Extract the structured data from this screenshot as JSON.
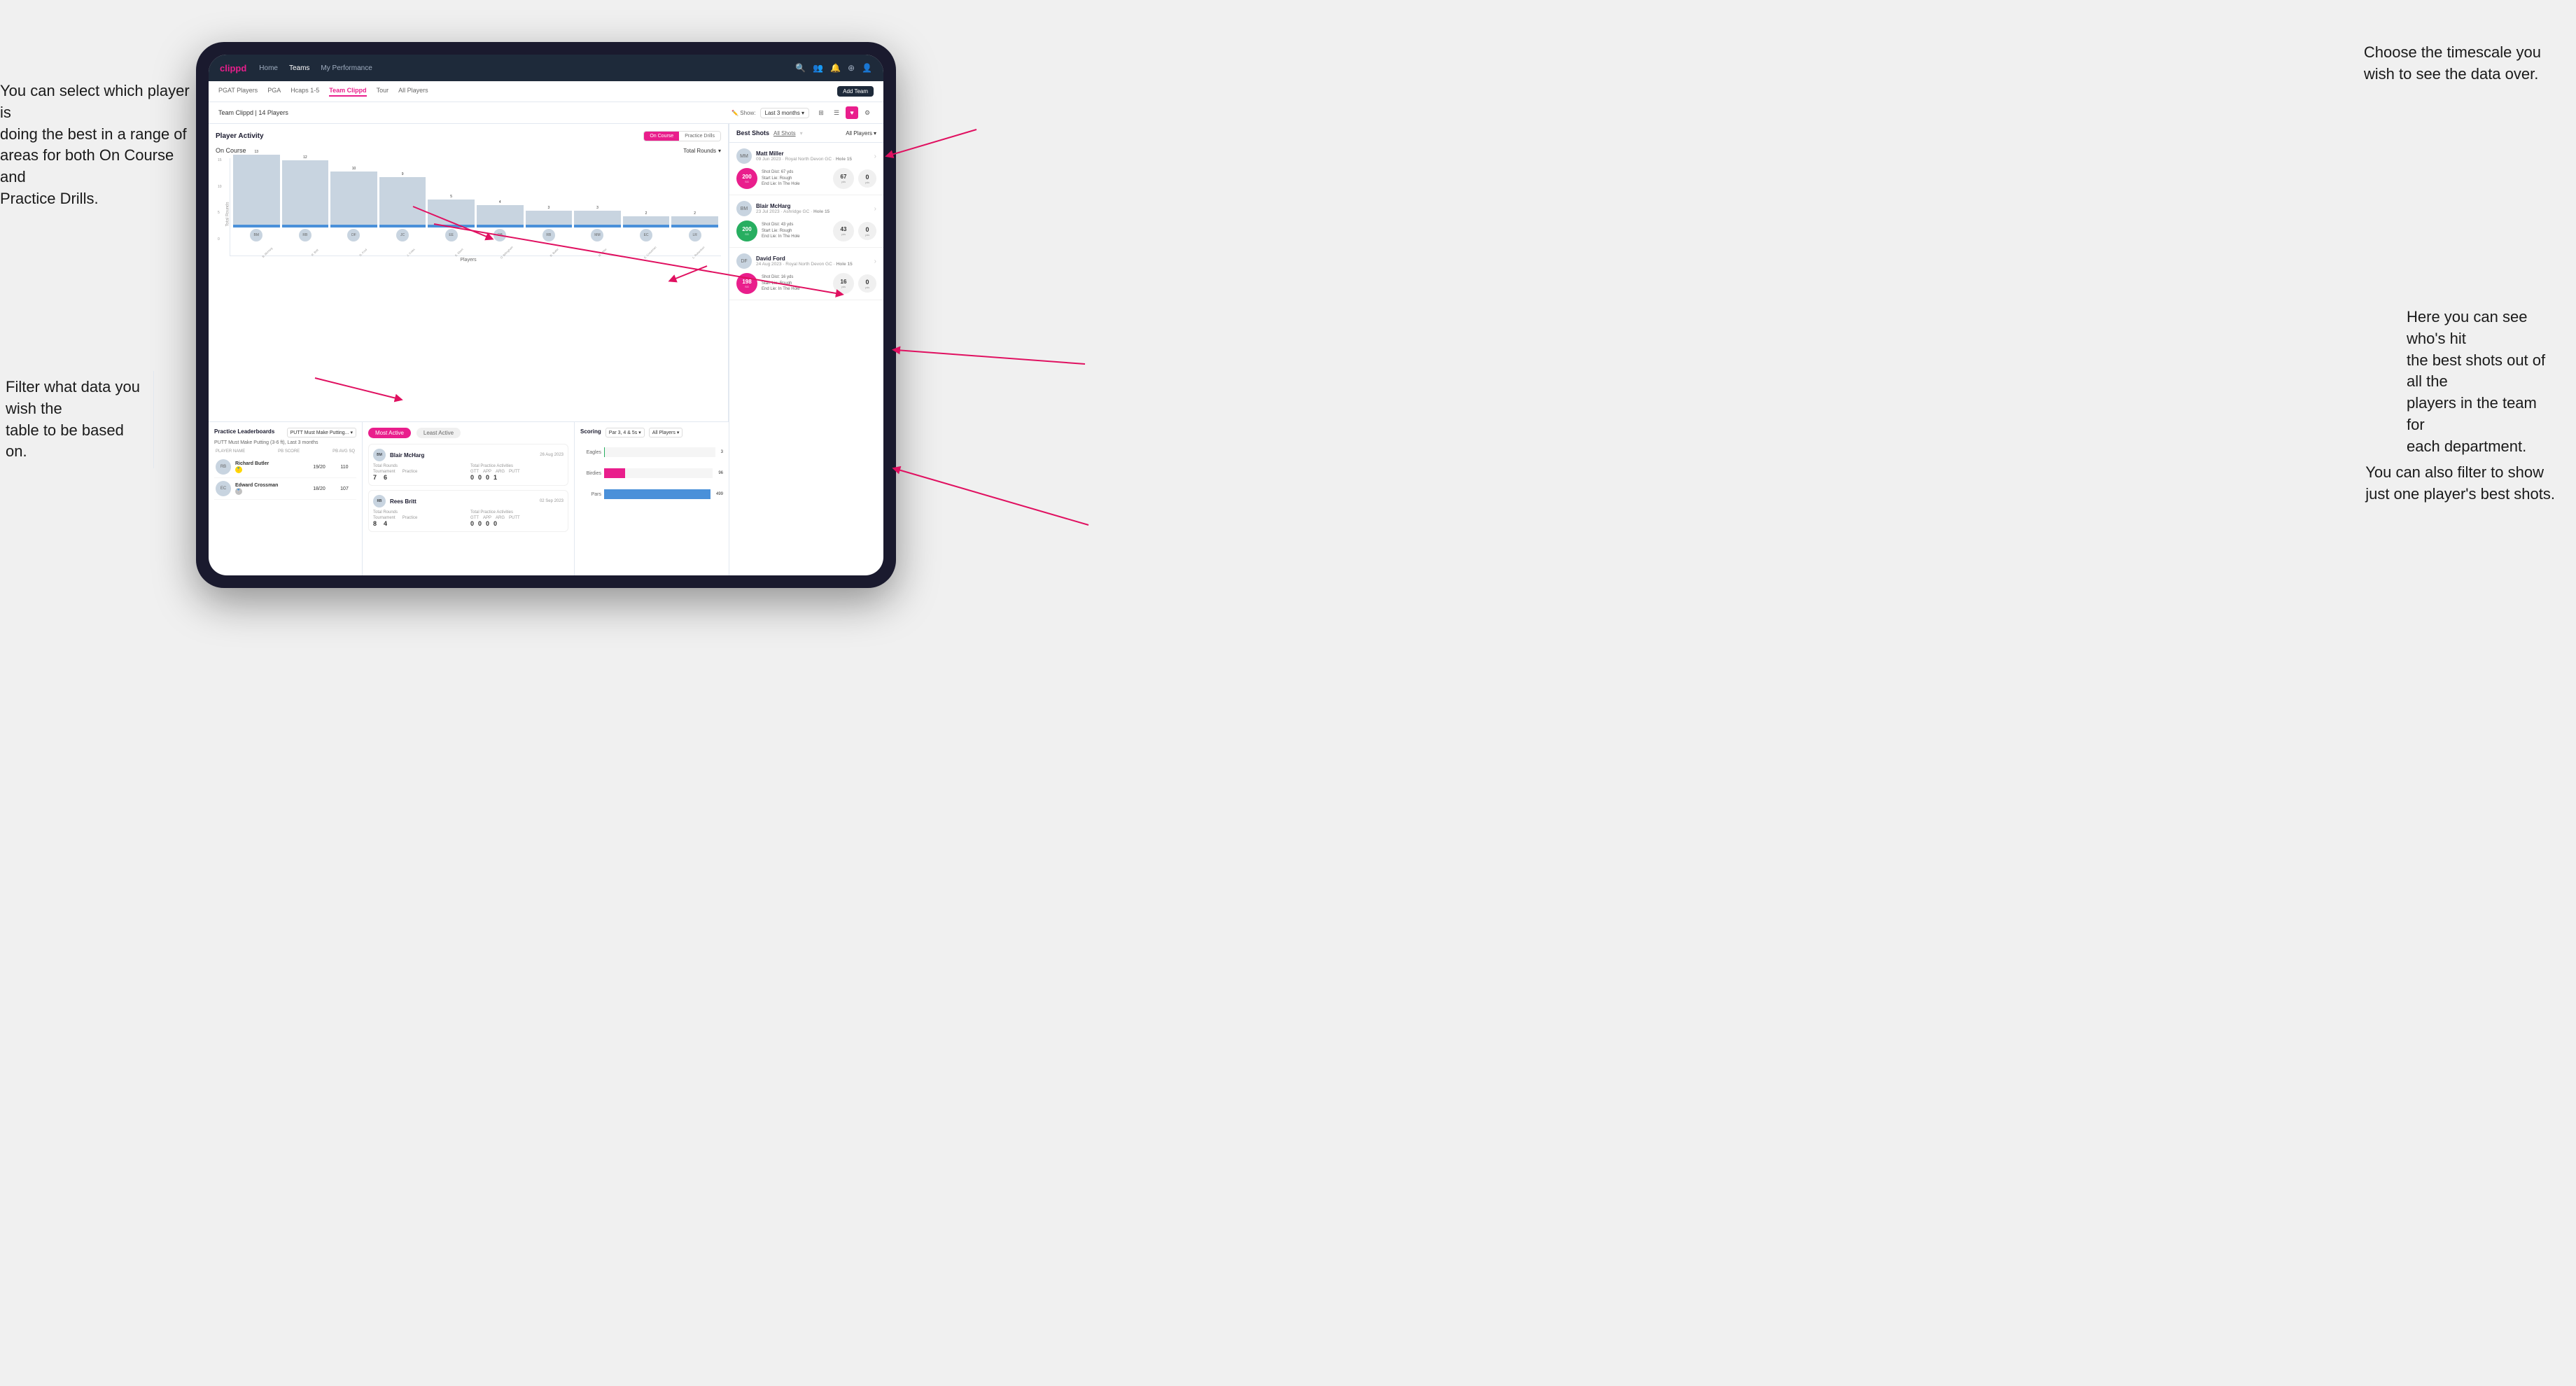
{
  "annotations": {
    "top_right": "Choose the timescale you\nwish to see the data over.",
    "top_left": "You can select which player is\ndoing the best in a range of\nareas for both On Course and\nPractice Drills.",
    "bottom_left": "Filter what data you wish the\ntable to be based on.",
    "bottom_right": "Here you can see who's hit\nthe best shots out of all the\nplayers in the team for\neach department.",
    "bottom_right2": "You can also filter to show\njust one player's best shots."
  },
  "nav": {
    "logo": "clippd",
    "links": [
      "Home",
      "Teams",
      "My Performance"
    ],
    "icons": [
      "search",
      "people",
      "bell",
      "add",
      "profile"
    ]
  },
  "sub_nav": {
    "tabs": [
      "PGAT Players",
      "PGA",
      "Hcaps 1-5",
      "Team Clippd",
      "Tour",
      "All Players"
    ],
    "active": "Team Clippd",
    "add_button": "Add Team"
  },
  "team_header": {
    "name": "Team Clippd | 14 Players",
    "show_label": "Show:",
    "time_filter": "Last 3 months",
    "views": [
      "grid",
      "list",
      "heart",
      "settings"
    ]
  },
  "player_activity": {
    "title": "Player Activity",
    "toggle": [
      "On Course",
      "Practice Drills"
    ],
    "active_toggle": "On Course",
    "section_title": "On Course",
    "chart_dropdown": "Total Rounds",
    "y_axis_label": "Total Rounds",
    "x_axis_label": "Players",
    "bars": [
      {
        "name": "B. McHarg",
        "value": 13
      },
      {
        "name": "R. Britt",
        "value": 12
      },
      {
        "name": "D. Ford",
        "value": 10
      },
      {
        "name": "J. Coles",
        "value": 9
      },
      {
        "name": "E. Ebert",
        "value": 5
      },
      {
        "name": "O. Billingham",
        "value": 4
      },
      {
        "name": "R. Butler",
        "value": 3
      },
      {
        "name": "M. Miller",
        "value": 3
      },
      {
        "name": "E. Crossman",
        "value": 2
      },
      {
        "name": "L. Robertson",
        "value": 2
      }
    ],
    "y_ticks": [
      "15",
      "10",
      "5",
      "0"
    ]
  },
  "best_shots": {
    "title": "Best Shots",
    "filters": [
      "All Shots",
      "All Players"
    ],
    "players": [
      {
        "name": "Matt Miller",
        "date": "09 Jun 2023",
        "course": "Royal North Devon GC",
        "hole": "Hole 15",
        "badge_num": "200",
        "badge_label": "SG",
        "shot_dist": "67 yds",
        "start_lie": "Rough",
        "end_lie": "In The Hole",
        "dist1": "67",
        "dist1_label": "yds",
        "dist2": "0",
        "dist2_label": "yds",
        "badge_color": "pink"
      },
      {
        "name": "Blair McHarg",
        "date": "23 Jul 2023",
        "course": "Ashridge GC",
        "hole": "Hole 15",
        "badge_num": "200",
        "badge_label": "SG",
        "shot_dist": "43 yds",
        "start_lie": "Rough",
        "end_lie": "In The Hole",
        "dist1": "43",
        "dist1_label": "yds",
        "dist2": "0",
        "dist2_label": "yds",
        "badge_color": "green"
      },
      {
        "name": "David Ford",
        "date": "24 Aug 2023",
        "course": "Royal North Devon GC",
        "hole": "Hole 15",
        "badge_num": "198",
        "badge_label": "SG",
        "shot_dist": "16 yds",
        "start_lie": "Rough",
        "end_lie": "In The Hole",
        "dist1": "16",
        "dist1_label": "yds",
        "dist2": "0",
        "dist2_label": "yds",
        "badge_color": "pink"
      }
    ]
  },
  "practice_leaderboards": {
    "title": "Practice Leaderboards",
    "dropdown": "PUTT Must Make Putting...",
    "subtitle": "PUTT Must Make Putting (3-6 ft), Last 3 months",
    "cols": [
      "PLAYER NAME",
      "PB SCORE",
      "PB AVG SQ"
    ],
    "players": [
      {
        "name": "Richard Butler",
        "score": "19/20",
        "avg": "110",
        "rank": "1"
      },
      {
        "name": "Edward Crossman",
        "score": "18/20",
        "avg": "107",
        "rank": "2"
      }
    ]
  },
  "most_active": {
    "tabs": [
      "Most Active",
      "Least Active"
    ],
    "active_tab": "Most Active",
    "players": [
      {
        "name": "Blair McHarg",
        "date": "26 Aug 2023",
        "total_rounds_label": "Total Rounds",
        "tournament": "7",
        "practice": "6",
        "activities_label": "Total Practice Activities",
        "gtt": "0",
        "app": "0",
        "arg": "0",
        "putt": "1"
      },
      {
        "name": "Rees Britt",
        "date": "02 Sep 2023",
        "total_rounds_label": "Total Rounds",
        "tournament": "8",
        "practice": "4",
        "activities_label": "Total Practice Activities",
        "gtt": "0",
        "app": "0",
        "arg": "0",
        "putt": "0"
      }
    ]
  },
  "scoring": {
    "title": "Scoring",
    "par_filter": "Par 3, 4 & 5s",
    "players_filter": "All Players",
    "bars": [
      {
        "label": "Eagles",
        "value": 3,
        "max": 500,
        "color": "eagles"
      },
      {
        "label": "Birdies",
        "value": 96,
        "max": 500,
        "color": "birdies"
      },
      {
        "label": "Pars",
        "value": 499,
        "max": 500,
        "color": "pars"
      }
    ]
  }
}
